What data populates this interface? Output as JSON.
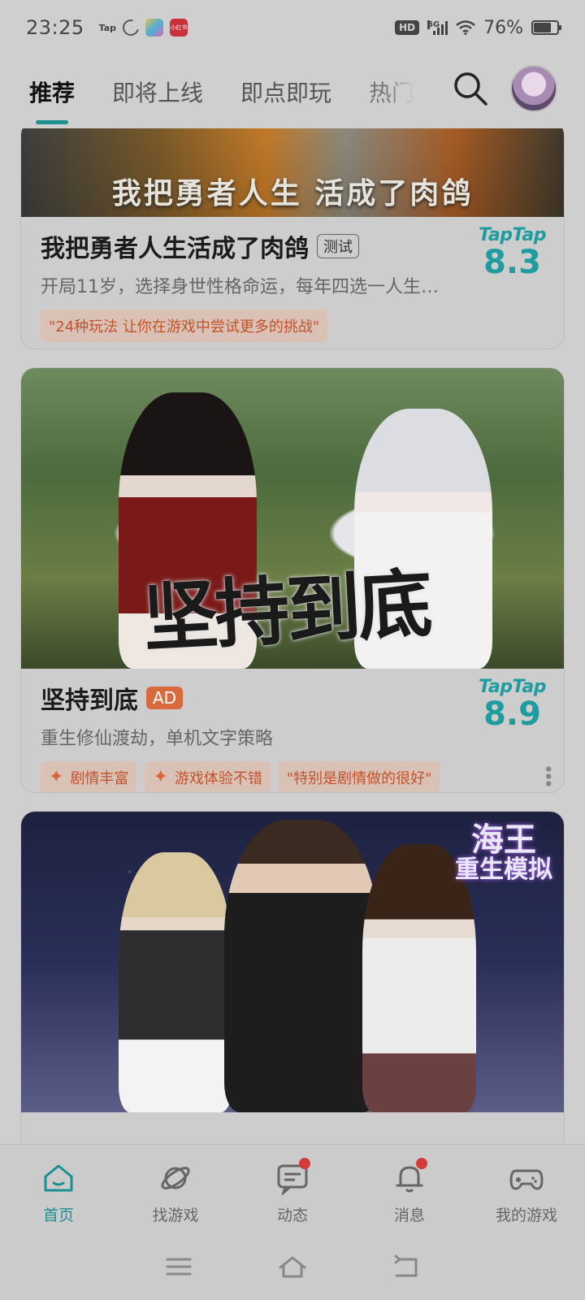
{
  "status": {
    "time": "23:25",
    "tap_label": "Tap",
    "app_badge": "小红书",
    "hd_label": "HD",
    "net_label": "5G",
    "battery_text": "76%",
    "battery_level": 0.76
  },
  "tabs": [
    {
      "label": "推荐",
      "active": true
    },
    {
      "label": "即将上线",
      "active": false
    },
    {
      "label": "即点即玩",
      "active": false
    },
    {
      "label": "热门",
      "active": false
    }
  ],
  "cards": [
    {
      "banner_text": "我把勇者人生 活成了肉鸽",
      "title": "我把勇者人生活成了肉鸽",
      "tag": "测试",
      "subtitle": "开局11岁，选择身世性格命运，每年四选一人生…",
      "chips": [
        "\"24种玩法 让你在游戏中尝试更多的挑战\""
      ],
      "rating_brand": "TapTap",
      "rating": "8.3"
    },
    {
      "image_title": "坚持到底",
      "title": "坚持到底",
      "tag": "AD",
      "subtitle": "重生修仙渡劫，单机文字策略",
      "chips": [
        "剧情丰富",
        "游戏体验不错",
        "\"特别是剧情做的很好\""
      ],
      "rating_brand": "TapTap",
      "rating": "8.9"
    },
    {
      "image_title_line1": "海王",
      "image_title_line2": "重生模拟"
    }
  ],
  "bottom_nav": [
    {
      "label": "首页",
      "icon": "home-icon",
      "active": true,
      "badge": false
    },
    {
      "label": "找游戏",
      "icon": "planet-icon",
      "active": false,
      "badge": false
    },
    {
      "label": "动态",
      "icon": "chat-icon",
      "active": false,
      "badge": true
    },
    {
      "label": "消息",
      "icon": "bell-icon",
      "active": false,
      "badge": true
    },
    {
      "label": "我的游戏",
      "icon": "gamepad-icon",
      "active": false,
      "badge": false
    }
  ],
  "colors": {
    "accent": "#1d8f92",
    "rating": "#1e9ca0",
    "chip_text": "#c4522a",
    "ad_tag": "#d86a3e",
    "badge_red": "#d33b3b"
  }
}
